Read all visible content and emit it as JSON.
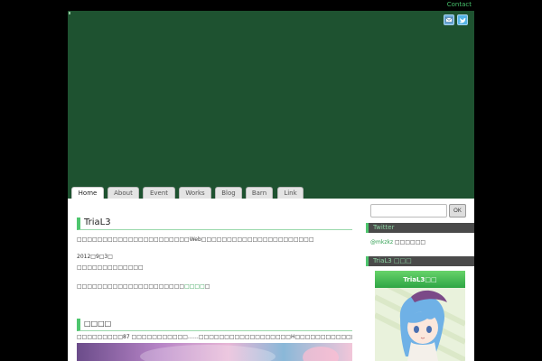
{
  "header": {
    "contact_label": "Contact"
  },
  "nav": {
    "tabs": [
      {
        "label": "Home",
        "active": true
      },
      {
        "label": "About"
      },
      {
        "label": "Event"
      },
      {
        "label": "Works"
      },
      {
        "label": "Blog"
      },
      {
        "label": "Barn"
      },
      {
        "label": "Link"
      }
    ]
  },
  "main": {
    "title": "TriaL3",
    "intro": "□□□□□□□□□□□□□□□□□□□□□□Web□□□□□□□□□□□□□□□□□□□□□□",
    "date": "2012□9□3□",
    "update_line": "□□□□□□□□□□□□□",
    "notice_prefix": "□□□□□□□□□□□□□□□□□□□□□",
    "notice_link": "□□□□",
    "notice_suffix": "□",
    "section2_title": "□□□□",
    "section2_text": "□□□□□□□□□87 □□□□□□□□□□□……□□□□□□□□□□□□□□□□□□H□□□□□□□□□□□□□□□"
  },
  "sidebar": {
    "search_placeholder": "",
    "search_button": "OK",
    "twitter_heading": "Twitter",
    "twitter_handle": "@mkzkz",
    "twitter_suffix": "□□□□□□",
    "section_heading": "TriaL3 □□□",
    "promo_title": "TriaL3□□"
  },
  "colors": {
    "header_bg": "#1e5230",
    "accent_green": "#4ec66e",
    "link_green": "#2e9e4f"
  },
  "icons": {
    "mail": "mail-icon",
    "twitter": "twitter-icon"
  }
}
